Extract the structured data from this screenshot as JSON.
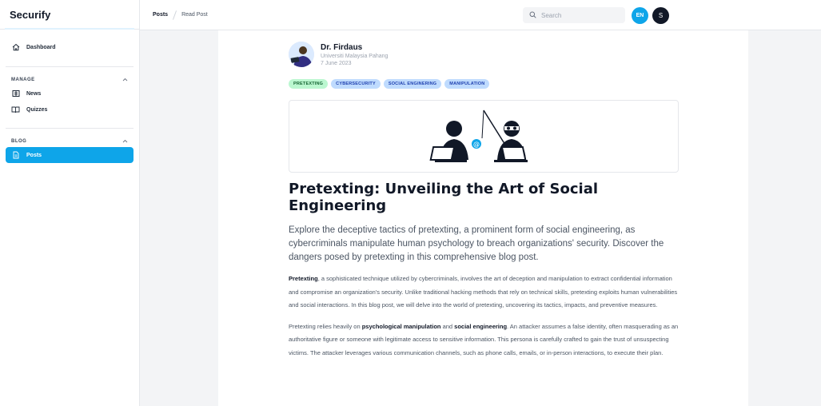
{
  "app": {
    "title": "Securify"
  },
  "sidebar": {
    "dashboard_label": "Dashboard",
    "manage_label": "MANAGE",
    "news_label": "News",
    "quizzes_label": "Quizzes",
    "blog_label": "BLOG",
    "posts_label": "Posts"
  },
  "breadcrumb": {
    "parent": "Posts",
    "current": "Read Post"
  },
  "search": {
    "placeholder": "Search"
  },
  "header": {
    "language": "EN",
    "user_initial": "S"
  },
  "post": {
    "author": {
      "name": "Dr. Firdaus",
      "affiliation": "Universiti Malaysia Pahang",
      "date": "7 June 2023"
    },
    "tags": [
      "PRETEXTING",
      "CYBERSECURITY",
      "SOCIAL ENGINERING",
      "MANIPULATION"
    ],
    "title": "Pretexting: Unveiling the Art of Social Engineering",
    "lead": "Explore the deceptive tactics of pretexting, a prominent form of social engineering, as cybercriminals manipulate human psychology to breach organizations' security. Discover the dangers posed by pretexting in this comprehensive blog post.",
    "p1_bold": "Pretexting",
    "p1_rest": ", a sophisticated technique utilized by cybercriminals, involves the art of deception and manipulation to extract confidential information and compromise an organization's security. Unlike traditional hacking methods that rely on technical skills, pretexting exploits human vulnerabilities and social interactions. In this blog post, we will delve into the world of pretexting, uncovering its tactics, impacts, and preventive measures.",
    "p2_a": "Pretexting relies heavily on ",
    "p2_b1": "psychological manipulation",
    "p2_c": " and ",
    "p2_b2": "social engineering",
    "p2_d": ". An attacker assumes a false identity, often masquerading as an authoritative figure or someone with legitimate access to sensitive information. This persona is carefully crafted to gain the trust of unsuspecting victims. The attacker leverages various communication channels, such as phone calls, emails, or in-person interactions, to execute their plan."
  },
  "colors": {
    "accent": "#0ea5e9",
    "dark": "#111827"
  }
}
